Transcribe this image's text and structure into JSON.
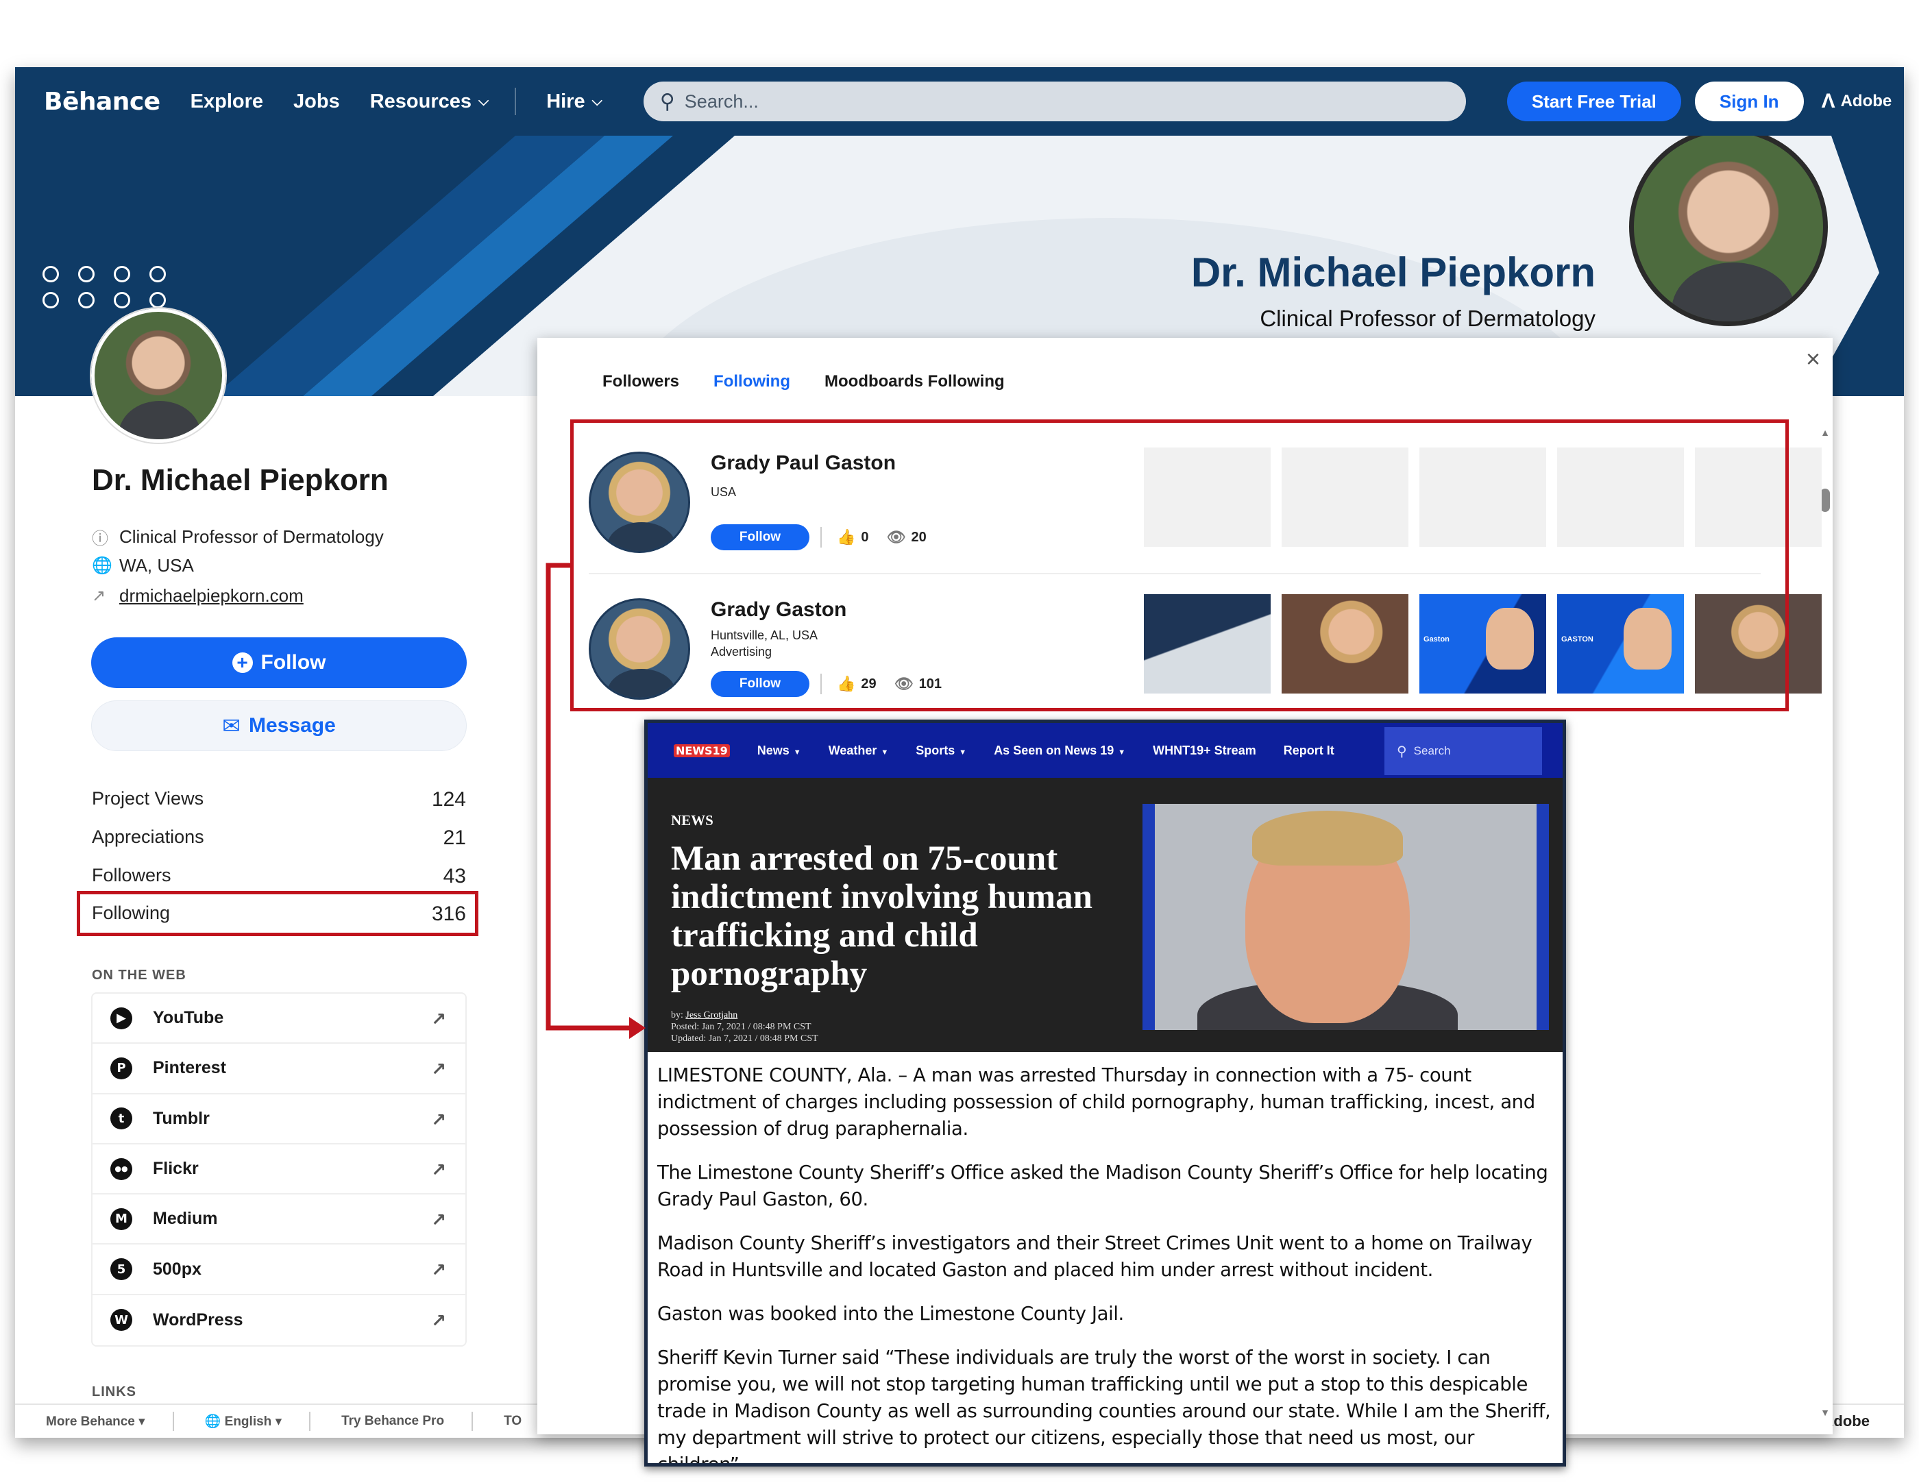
{
  "header": {
    "logo": "Bēhance",
    "nav": [
      "Explore",
      "Jobs",
      "Resources",
      "Hire"
    ],
    "search_placeholder": "Search...",
    "trial_label": "Start Free Trial",
    "signin_label": "Sign In",
    "adobe_label": "Adobe"
  },
  "banner": {
    "name": "Dr. Michael Piepkorn",
    "role": "Clinical Professor of Dermatology"
  },
  "profile": {
    "name": "Dr. Michael Piepkorn",
    "title": "Clinical Professor of Dermatology",
    "location": "WA, USA",
    "website": "drmichaelpiepkorn.com",
    "follow_label": "Follow",
    "message_label": "Message",
    "stats": [
      {
        "label": "Project Views",
        "value": "124"
      },
      {
        "label": "Appreciations",
        "value": "21"
      },
      {
        "label": "Followers",
        "value": "43"
      },
      {
        "label": "Following",
        "value": "316"
      }
    ],
    "on_the_web_heading": "ON THE WEB",
    "web_links": [
      {
        "label": "YouTube",
        "glyph": "▶"
      },
      {
        "label": "Pinterest",
        "glyph": "P"
      },
      {
        "label": "Tumblr",
        "glyph": "t"
      },
      {
        "label": "Flickr",
        "glyph": "●●"
      },
      {
        "label": "Medium",
        "glyph": "M"
      },
      {
        "label": "500px",
        "glyph": "5"
      },
      {
        "label": "WordPress",
        "glyph": "W"
      }
    ],
    "links_heading": "LINKS"
  },
  "footer": {
    "more": "More Behance",
    "language": "English",
    "pro": "Try Behance Pro",
    "tos": "TO",
    "adobe": "Adobe"
  },
  "modal": {
    "tabs": [
      "Followers",
      "Following",
      "Moodboards Following"
    ],
    "active_tab": "Following",
    "close": "×",
    "users": [
      {
        "name": "Grady Paul Gaston",
        "location": "USA",
        "field": "",
        "follow_label": "Follow",
        "appreciations": "0",
        "views": "20"
      },
      {
        "name": "Grady Gaston",
        "location": "Huntsville, AL, USA",
        "field": "Advertising",
        "follow_label": "Follow",
        "appreciations": "29",
        "views": "101"
      }
    ],
    "thumb_labels": [
      "Gaston",
      "GASTON"
    ]
  },
  "news": {
    "logo": "NEWS19",
    "nav": [
      "News",
      "Weather",
      "Sports",
      "As Seen on News 19",
      "WHNT19+ Stream",
      "Report It"
    ],
    "search_label": "Search",
    "kicker": "NEWS",
    "headline": "Man arrested on 75-count indictment involving human trafficking and child pornography",
    "byline_prefix": "by: ",
    "author": "Jess Grotjahn",
    "posted": "Posted: Jan 7, 2021 / 08:48 PM CST",
    "updated": "Updated: Jan 7, 2021 / 08:48 PM CST",
    "paragraphs": [
      "LIMESTONE COUNTY, Ala. – A man was arrested Thursday in connection with a 75- count indictment of charges including possession of child pornography, human trafficking, incest, and possession of drug paraphernalia.",
      "The Limestone County Sheriff’s Office asked the Madison County Sheriff’s Office for help locating Grady Paul Gaston, 60.",
      "Madison County Sheriff’s investigators and their Street Crimes Unit went to a home on Trailway Road in Huntsville and located Gaston and placed him under arrest without incident.",
      "Gaston was booked into the Limestone County Jail.",
      "Sheriff Kevin Turner said “These individuals are truly the worst of the worst in society. I can promise you, we will not stop targeting human trafficking until we put a stop to this despicable trade in Madison County as well as surrounding counties around our state. While I am the Sheriff, my department will strive to protect our citizens, especially those that need us most, our children”."
    ]
  },
  "colors": {
    "header_bg": "#0f3b66",
    "accent": "#1466f3",
    "highlight": "#c0141d",
    "news_nav": "#0d1f9b"
  }
}
